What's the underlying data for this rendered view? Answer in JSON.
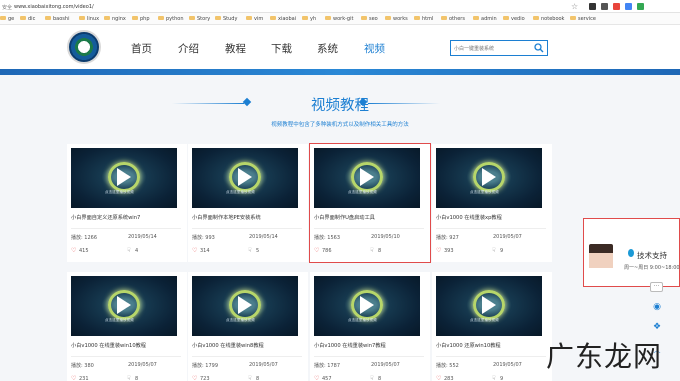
{
  "browser": {
    "security_label": "安全",
    "url": "www.xiaobaixitong.com/video1/",
    "bookmarks": [
      "ge",
      "dic",
      "baoshi",
      "linux",
      "nginx",
      "php",
      "python",
      "Story",
      "Study",
      "vim",
      "xiaobai",
      "yh",
      "work-git",
      "seo",
      "works",
      "html",
      "others",
      "admin",
      "vedio",
      "notebook",
      "service"
    ]
  },
  "header": {
    "nav": [
      "首页",
      "介绍",
      "教程",
      "下载",
      "系统",
      "视频"
    ],
    "active_nav": "视频",
    "search_placeholder": "小白一键重装系统"
  },
  "section": {
    "title": "视频教程",
    "subtitle": "视频教程中包含了多种装机方式以及制作相关工具的方法"
  },
  "thumb_caption": "点击这里播放视频",
  "play_label": "播放:",
  "cards": [
    {
      "title": "小白界面自定义还原系统win7",
      "plays": "1266",
      "date": "2019/05/14",
      "likes": "415",
      "downs": "4"
    },
    {
      "title": "小白界面制作本地PE安装系统",
      "plays": "993",
      "date": "2019/05/14",
      "likes": "314",
      "downs": "5"
    },
    {
      "title": "小白界面制作U盘启动工具",
      "plays": "1563",
      "date": "2019/05/10",
      "likes": "786",
      "downs": "8"
    },
    {
      "title": "小白v1000 在线重装xp教程",
      "plays": "927",
      "date": "2019/05/07",
      "likes": "393",
      "downs": "9"
    },
    {
      "title": "小白v1000 在线重装win10教程",
      "plays": "380",
      "date": "2019/05/07",
      "likes": "231",
      "downs": "8"
    },
    {
      "title": "小白v1000 在线重装win8教程",
      "plays": "1799",
      "date": "2019/05/07",
      "likes": "723",
      "downs": "8"
    },
    {
      "title": "小白v1000 在线重装win7教程",
      "plays": "1787",
      "date": "2019/05/07",
      "likes": "457",
      "downs": "8"
    },
    {
      "title": "小白v1000 还原win10教程",
      "plays": "552",
      "date": "2019/05/07",
      "likes": "283",
      "downs": "9"
    }
  ],
  "support": {
    "title": "技术支持",
    "hours": "周一~周日 9:00~18:00"
  },
  "watermark": "广东龙网",
  "colors": {
    "accent": "#1c7fd2",
    "highlight": "#e04b4b",
    "heart": "#e53f3f"
  }
}
